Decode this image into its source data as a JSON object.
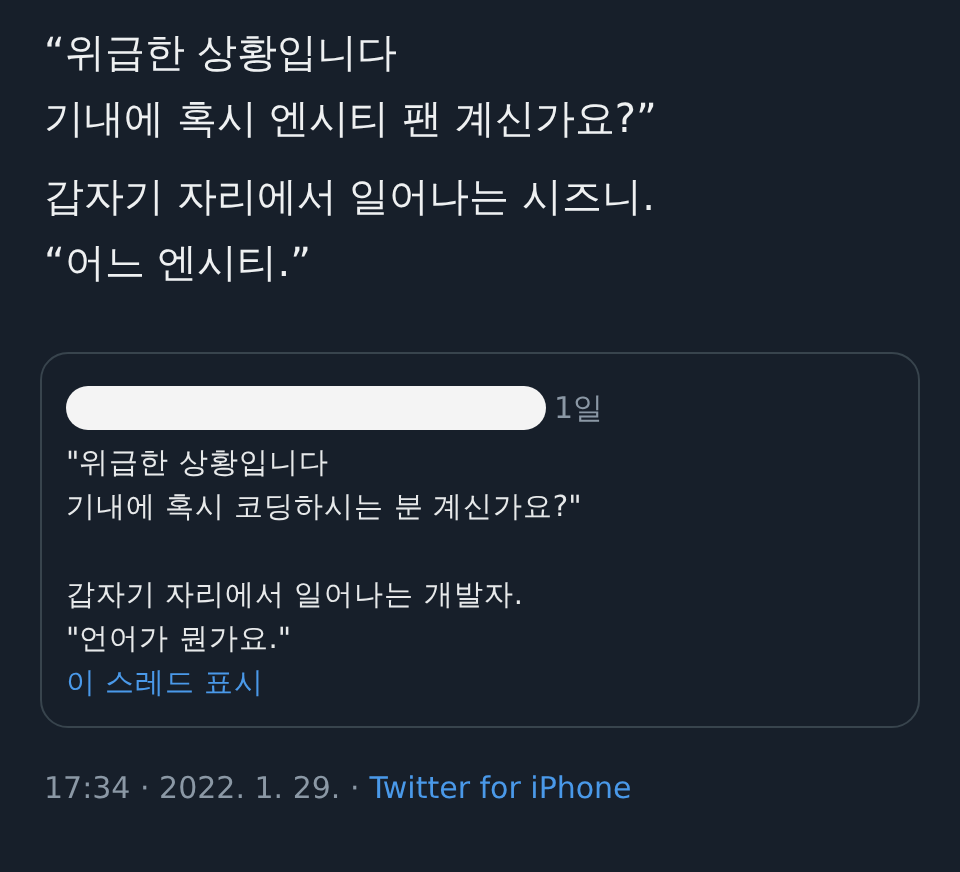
{
  "tweet": {
    "paragraphs": [
      "“위급한 상황입니다\n기내에 혹시 엔시티 팬 계신가요?”",
      "갑자기 자리에서 일어나는 시즈니.\n“어느 엔시티.”"
    ]
  },
  "quoted_tweet": {
    "redacted": true,
    "time": "1일",
    "text": "\"위급한 상황입니다\n기내에 혹시 코딩하시는 분 계신가요?\"\n\n갑자기 자리에서 일어나는 개발자.\n\"언어가 뭔가요.\"",
    "thread_link": "이 스레드 표시"
  },
  "meta": {
    "timestamp": "17:34 · 2022. 1. 29. ·",
    "source": "Twitter for iPhone"
  }
}
